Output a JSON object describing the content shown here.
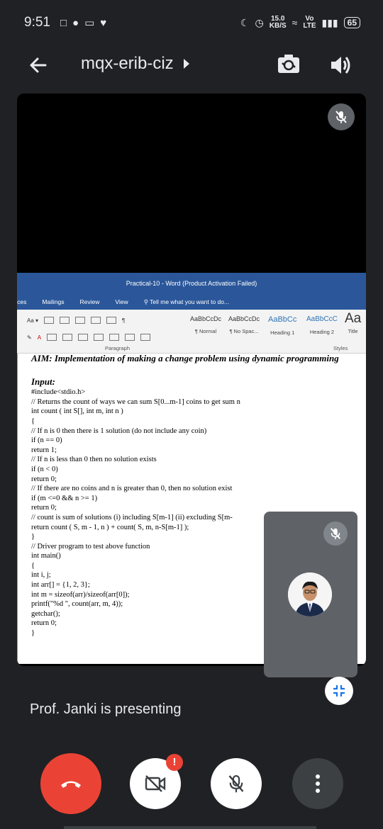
{
  "status_bar": {
    "time": "9:51",
    "net_speed_value": "15.0",
    "net_speed_unit": "KB/S",
    "volte": "Vo",
    "volte_sub": "LTE",
    "battery": "65"
  },
  "header": {
    "meeting_code": "mqx-erib-ciz"
  },
  "document": {
    "window_title": "Practical-10 - Word (Product Activation Failed)",
    "tabs": [
      "eferences",
      "Mailings",
      "Review",
      "View"
    ],
    "tell_me": "Tell me what you want to do...",
    "font_size_label": "Aa",
    "styles": [
      {
        "sample": "AaBbCcDc",
        "name": "¶ Normal"
      },
      {
        "sample": "AaBbCcDc",
        "name": "¶ No Spac..."
      },
      {
        "sample": "AaBbCc",
        "name": "Heading 1"
      },
      {
        "sample": "AaBbCcC",
        "name": "Heading 2"
      },
      {
        "sample": "Aa",
        "name": "Title"
      }
    ],
    "paragraph_label": "Paragraph",
    "styles_label": "Styles",
    "aim": "AIM: Implementation of making a change problem using dynamic programming",
    "input_heading": "Input:",
    "code_lines": [
      "#include<stdio.h>",
      "// Returns the count of ways we can sum S[0...m-1] coins to get sum n",
      "int count ( int S[], int m, int n )",
      "{",
      "// If n is 0 then there is 1 solution (do not include any coin)",
      "if (n == 0)",
      "return 1;",
      "// If n is less than 0 then no solution exists",
      "if (n < 0)",
      "return 0;",
      "// If there are no coins and n is greater than 0, then no solution exist",
      "if (m <=0 && n >= 1)",
      "return 0;",
      "// count is sum of solutions (i) including S[m-1] (ii) excluding S[m-",
      "return count ( S, m - 1, n ) + count( S, m, n-S[m-1] );",
      "}",
      "// Driver program to test above function",
      "int main()",
      "{",
      "int i, j;",
      "int arr[] = {1, 2, 3};",
      "int m = sizeof(arr)/sizeof(arr[0]);",
      "printf(\"%d \", count(arr, m, 4));",
      "getchar();",
      "return 0;",
      "}"
    ]
  },
  "presenting_text": "Prof. Janki is presenting",
  "camera_alert": "!",
  "colors": {
    "background": "#202124",
    "end_call": "#ea4335",
    "word_blue": "#2b579a",
    "tile_grey": "#5f6368"
  },
  "icons": {
    "back": "arrow-left-icon",
    "switch_camera": "switch-camera-icon",
    "speaker": "speaker-icon",
    "mic_off": "mic-off-icon",
    "unpin": "exit-fullscreen-icon",
    "end_call": "phone-hangup-icon",
    "camera_off": "camera-off-icon",
    "more": "more-vert-icon"
  }
}
